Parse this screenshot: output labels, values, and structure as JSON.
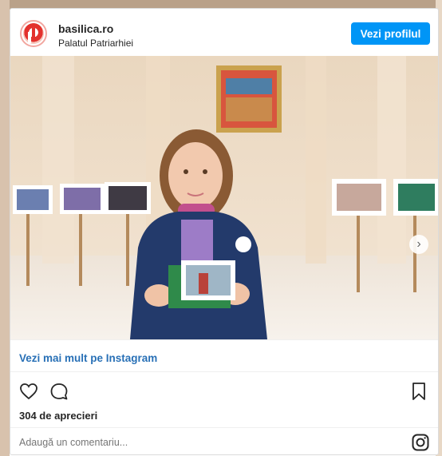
{
  "post": {
    "username": "basilica.ro",
    "location": "Palatul Patriarhiei",
    "view_profile_label": "Vezi profilul",
    "more_on_instagram": "Vezi mai mult pe Instagram",
    "likes_text": "304 de aprecieri",
    "comment_placeholder": "Adaugă un comentariu..."
  },
  "icons": {
    "like": "heart-icon",
    "comment": "comment-icon",
    "save": "bookmark-icon",
    "instagram": "instagram-icon",
    "next": "chevron-right-icon"
  },
  "colors": {
    "button": "#0095f6",
    "link": "#2870b6",
    "text": "#262626",
    "muted": "#8e8e8e"
  }
}
